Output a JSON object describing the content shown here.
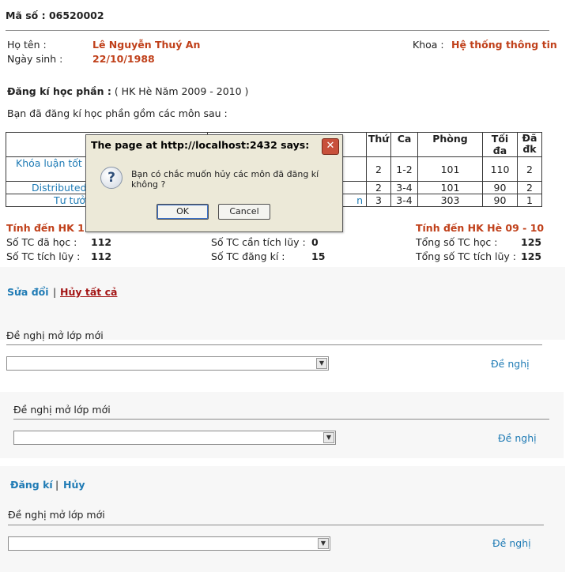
{
  "header": {
    "ma_so_label": "Mã số :",
    "ma_so_value": "06520002"
  },
  "student": {
    "ho_ten_label": "Họ tên  :",
    "ho_ten_value": "Lê Nguyễn Thuý An",
    "ngay_sinh_label": "Ngày sinh :",
    "ngay_sinh_value": "22/10/1988",
    "khoa_label": "Khoa :",
    "khoa_value": "Hệ thống thông tin"
  },
  "registration": {
    "label": "Đăng kí học phần :",
    "term": "( HK Hè Năm 2009 - 2010 )",
    "intro": "Bạn đã đăng kí học phần gồm các môn sau :"
  },
  "table": {
    "headers": [
      "Thứ",
      "Ca",
      "Phòng",
      "Tối đa",
      "Đã đk"
    ],
    "rows": [
      {
        "course": "Khóa luận tốt",
        "thu": "2",
        "ca": "1-2",
        "phong": "101",
        "toida": "110",
        "dadk": "2"
      },
      {
        "course": "Distributed",
        "thu": "2",
        "ca": "3-4",
        "phong": "101",
        "toida": "90",
        "dadk": "2"
      },
      {
        "course": "Tư tưở",
        "thu": "3",
        "ca": "3-4",
        "phong": "303",
        "toida": "90",
        "dadk": "1"
      }
    ],
    "row3_tail": "n"
  },
  "summary": {
    "left_title": "Tính đến HK 1 N",
    "right_title": "Tính đến HK Hè  09 - 10",
    "so_tc_da_hoc_label": "Số TC đã học :",
    "so_tc_da_hoc_value": "112",
    "so_tc_tich_luy_label": "Số TC tích lũy :",
    "so_tc_tich_luy_value": "112",
    "so_tc_can_label": "Số TC cần tích lũy :",
    "so_tc_can_value": "0",
    "so_tc_dang_ki_label": "Số TC đăng kí :",
    "so_tc_dang_ki_value": "15",
    "tong_hoc_label": "Tổng số TC  học :",
    "tong_hoc_value": "125",
    "tong_tich_luy_label": "Tổng số TC tích lũy :",
    "tong_tich_luy_value": "125"
  },
  "actions1": {
    "sua_doi": "Sửa đổi",
    "separator": "|",
    "huy_tat_ca": "Hủy tất cả"
  },
  "proposal1": {
    "label": "Đề nghị mở lớp mới",
    "select_value": "",
    "button": "Đề nghị"
  },
  "proposal2": {
    "label": "Đề nghị mở lớp mới",
    "select_value": "",
    "button": "Đề nghị"
  },
  "actions2": {
    "dang_ki": "Đăng kí",
    "separator": "|",
    "huy": "Hủy"
  },
  "proposal3": {
    "label": "Đề nghị mở lớp mới",
    "select_value": "",
    "button": "Đề nghị"
  },
  "dialog": {
    "title": "The page at http://localhost:2432 says:",
    "close_glyph": "✕",
    "icon": "question-icon",
    "icon_glyph": "?",
    "message": "Bạn có chắc muốn hủy các môn đã đăng kí không ?",
    "ok": "OK",
    "cancel": "Cancel"
  },
  "colors": {
    "accent_orange": "#c0401a",
    "link_blue": "#1f7bb5",
    "link_red": "#a31515"
  }
}
